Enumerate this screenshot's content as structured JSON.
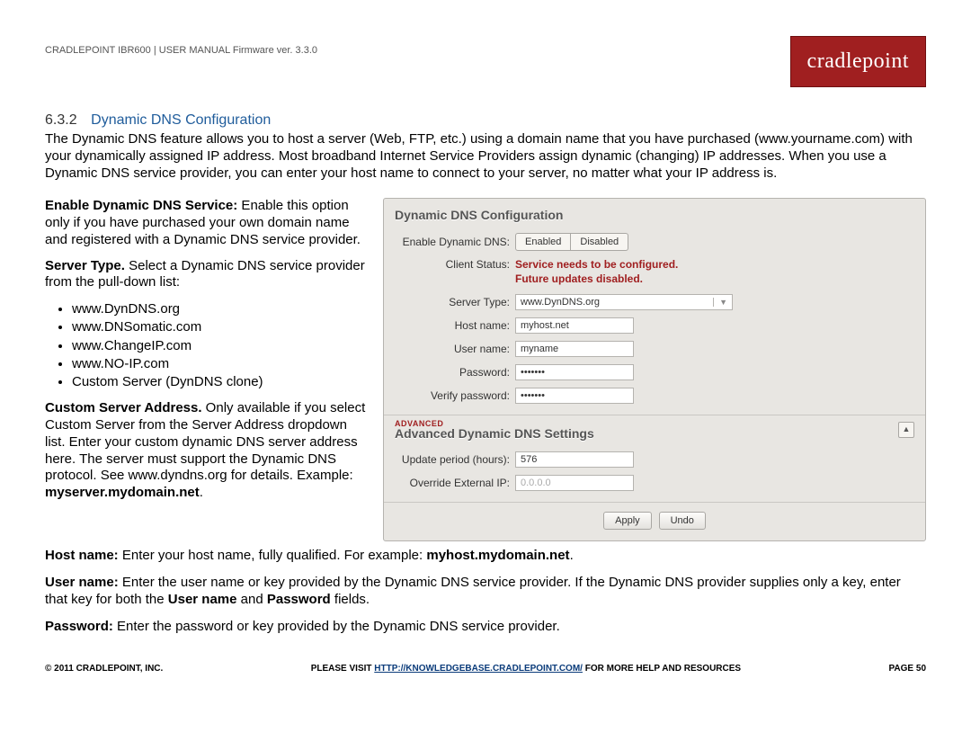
{
  "header": {
    "manual": "CRADLEPOINT IBR600 | USER MANUAL Firmware ver. 3.3.0",
    "logo": "cradlepoint"
  },
  "section": {
    "num": "6.3.2",
    "title": "Dynamic DNS Configuration",
    "intro": "The Dynamic DNS feature allows you to host a server (Web, FTP, etc.) using a domain name that you have purchased (www.yourname.com) with your dynamically assigned IP address. Most broadband Internet Service Providers assign dynamic (changing) IP addresses. When you use a Dynamic DNS service provider, you can enter your host name to connect to your server, no matter what your IP address is."
  },
  "left": {
    "enable_bold": "Enable Dynamic DNS Service:",
    "enable_rest": " Enable this option only if you have purchased your own domain name and registered with a Dynamic DNS service provider.",
    "server_bold": "Server Type.",
    "server_rest": " Select a Dynamic DNS service provider from the pull-down list:",
    "providers": [
      "www.DynDNS.org",
      "www.DNSomatic.com",
      "www.ChangeIP.com",
      "www.NO-IP.com",
      "Custom Server (DynDNS clone)"
    ],
    "custom_bold": "Custom Server Address.",
    "custom_rest": " Only available if you select Custom Server from the Server Address dropdown list. Enter your custom dynamic DNS server address here. The server must support the Dynamic DNS protocol. See www.dyndns.org for details. Example: ",
    "custom_example": "myserver.mydomain.net",
    "period": "."
  },
  "panel": {
    "title": "Dynamic DNS Configuration",
    "enable_label": "Enable Dynamic DNS:",
    "enabled": "Enabled",
    "disabled": "Disabled",
    "client_status_label": "Client Status:",
    "status1": "Service needs to be configured.",
    "status2": "Future updates disabled.",
    "server_type_label": "Server Type:",
    "server_type_value": "www.DynDNS.org",
    "host_label": "Host name:",
    "host_value": "myhost.net",
    "user_label": "User name:",
    "user_value": "myname",
    "pass_label": "Password:",
    "pass_value": "•••••••",
    "verify_label": "Verify password:",
    "verify_value": "•••••••",
    "adv_tag": "ADVANCED",
    "adv_title": "Advanced Dynamic DNS Settings",
    "update_label": "Update period (hours):",
    "update_value": "576",
    "override_label": "Override External IP:",
    "override_value": "0.0.0.0",
    "apply": "Apply",
    "undo": "Undo"
  },
  "lower": {
    "host_bold": "Host name:",
    "host_rest": " Enter your host name, fully qualified. For example: ",
    "host_ex": "myhost.mydomain.net",
    "user_bold": "User name:",
    "user_rest": " Enter the user name or key provided by the Dynamic DNS service provider. If the Dynamic DNS provider supplies only a key, enter that key for both the ",
    "user_un": "User name",
    "user_and": " and ",
    "user_pw": "Password",
    "user_end": " fields.",
    "pass_bold": "Password:",
    "pass_rest": " Enter the password or key provided by the Dynamic DNS service provider."
  },
  "footer": {
    "copyright": "© 2011 CRADLEPOINT, INC.",
    "visit_pre": "PLEASE VISIT ",
    "visit_link": "HTTP://KNOWLEDGEBASE.CRADLEPOINT.COM/",
    "visit_post": " FOR MORE HELP AND RESOURCES",
    "page": "PAGE 50"
  }
}
